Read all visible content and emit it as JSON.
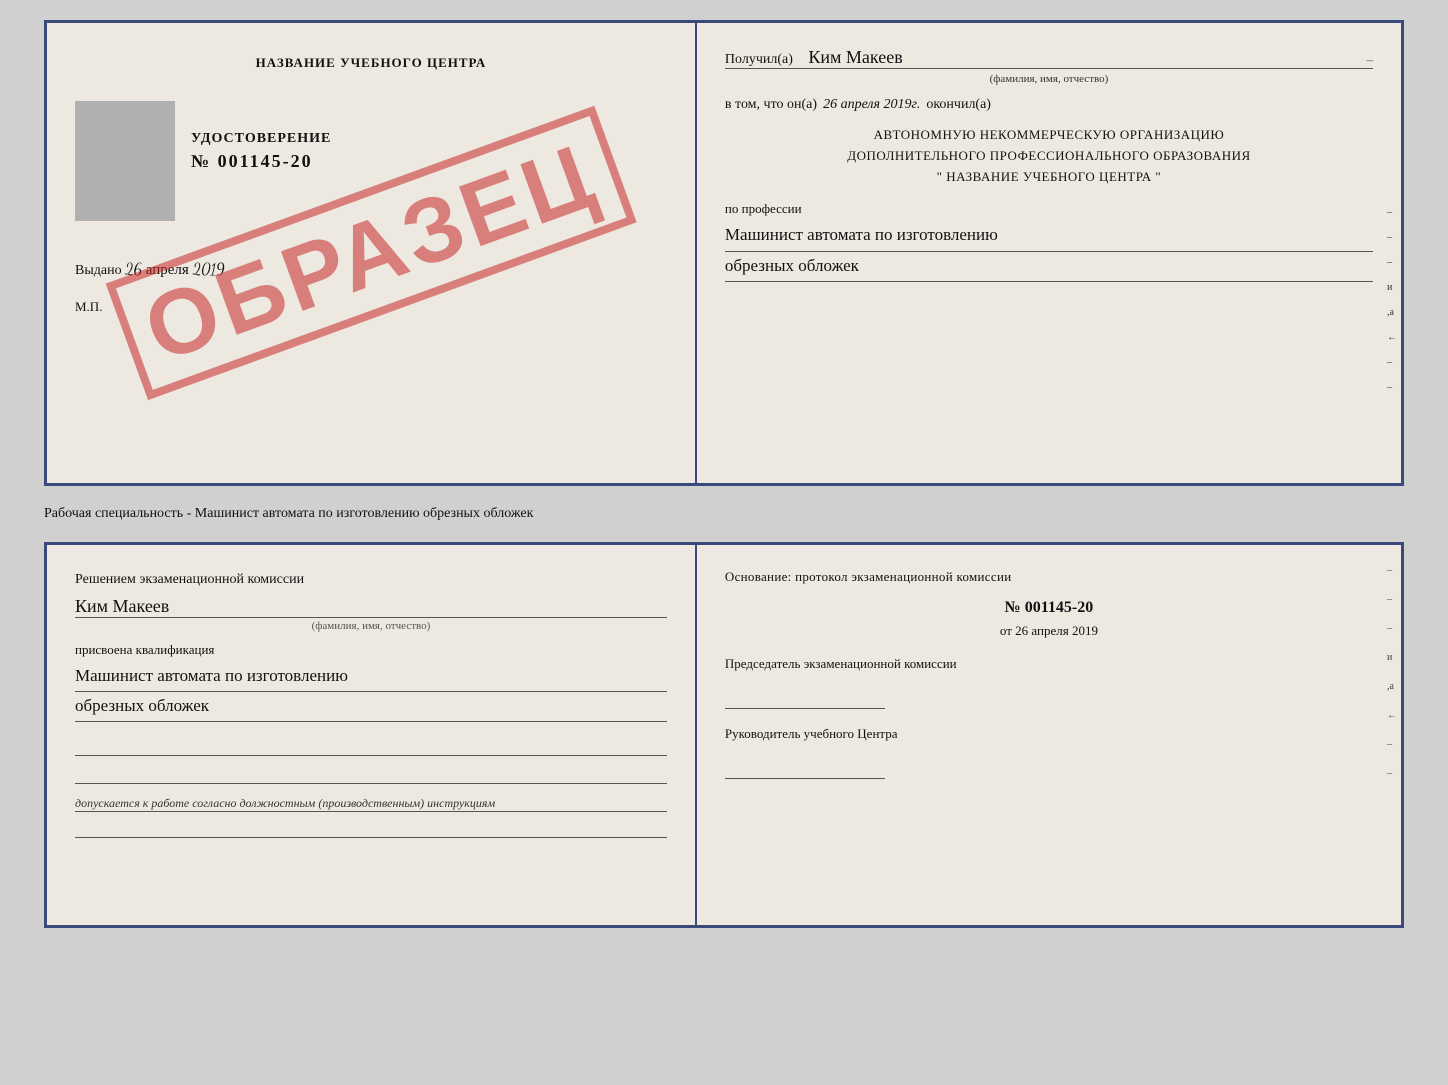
{
  "top_doc": {
    "left": {
      "school_title": "НАЗВАНИЕ УЧЕБНОГО ЦЕНТРА",
      "stamp_text": "ОБРАЗЕЦ",
      "cert_label": "УДОСТОВЕРЕНИЕ",
      "cert_number": "№ 001145-20",
      "issued_prefix": "Выдано",
      "issued_date": "26 апреля 2019",
      "mp_label": "М.П."
    },
    "right": {
      "received_prefix": "Получил(а)",
      "recipient_name": "Ким Макеев",
      "name_subtitle": "(фамилия, имя, отчество)",
      "date_prefix": "в том, что он(а)",
      "date_value": "26 апреля 2019г.",
      "date_suffix": "окончил(а)",
      "org_line1": "АВТОНОМНУЮ НЕКОММЕРЧЕСКУЮ ОРГАНИЗАЦИЮ",
      "org_line2": "ДОПОЛНИТЕЛЬНОГО ПРОФЕССИОНАЛЬНОГО ОБРАЗОВАНИЯ",
      "org_name": "\"    НАЗВАНИЕ УЧЕБНОГО ЦЕНТРА    \"",
      "profession_prefix": "по профессии",
      "profession_line1": "Машинист автомата по изготовлению",
      "profession_line2": "обрезных обложек",
      "edge_chars": [
        "–",
        "–",
        "–",
        "и",
        ",а",
        "←–",
        "–",
        "–",
        "–"
      ]
    }
  },
  "separator": {
    "text": "Рабочая специальность - Машинист автомата по изготовлению обрезных обложек"
  },
  "bottom_doc": {
    "left": {
      "decision_text": "Решением экзаменационной комиссии",
      "name_value": "Ким Макеев",
      "name_subtitle": "(фамилия, имя, отчество)",
      "qual_prefix": "присвоена квалификация",
      "qual_line1": "Машинист автомата по изготовлению",
      "qual_line2": "обрезных обложек",
      "допуск_text": "допускается к работе согласно должностным (производственным) инструкциям"
    },
    "right": {
      "osnov_title": "Основание: протокол экзаменационной комиссии",
      "protocol_number": "№ 001145-20",
      "protocol_date_prefix": "от",
      "protocol_date": "26 апреля 2019",
      "chairman_role": "Председатель экзаменационной комиссии",
      "director_role": "Руководитель учебного Центра",
      "edge_chars": [
        "–",
        "–",
        "–",
        "и",
        ",а",
        "←–",
        "–",
        "–",
        "–"
      ]
    }
  }
}
